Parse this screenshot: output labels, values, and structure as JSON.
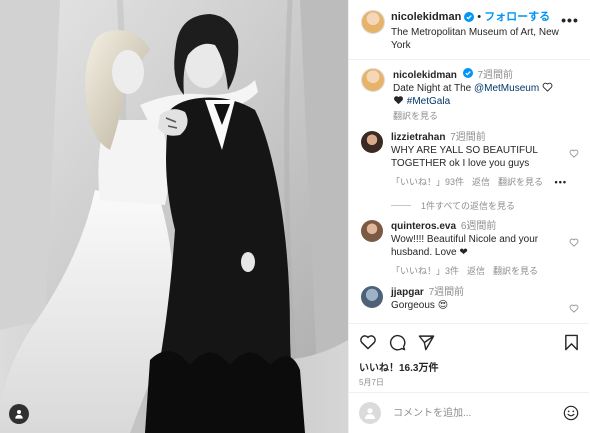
{
  "post": {
    "username": "nicolekidman",
    "follow_label": "フォローする",
    "separator": "•",
    "location": "The Metropolitan Museum of Art, New York",
    "more_label": "•••"
  },
  "caption": {
    "username": "nicolekidman",
    "time": "7週間前",
    "text_before": "Date Night at The ",
    "mention": "@MetMuseum",
    "hashtag": "#MetGala",
    "translate": "翻訳を見る"
  },
  "comments": [
    {
      "username": "lizzietrahan",
      "time": "7週間前",
      "text": "WHY ARE YALL SO BEAUTIFUL TOGETHER ok I love you guys",
      "likes": "「いいね！」93件",
      "reply": "返信",
      "translate": "翻訳を見る",
      "more": "•••",
      "replies_label": "1件すべての返信を見る"
    },
    {
      "username": "quinteros.eva",
      "time": "6週間前",
      "text": "Wow!!!! Beautiful Nicole and your husband. Love ❤",
      "likes": "「いいね！」3件",
      "reply": "返信",
      "translate": "翻訳を見る"
    },
    {
      "username": "jjapgar",
      "time": "7週間前",
      "text": "Gorgeous 😍"
    }
  ],
  "actions": {
    "likes": "いいね！16.3万件",
    "date": "5月7日"
  },
  "comment_box": {
    "placeholder": "コメントを追加..."
  },
  "colors": {
    "accent": "#0095f6",
    "link": "#00376b",
    "muted": "#8e8e8e",
    "text": "#262626"
  }
}
